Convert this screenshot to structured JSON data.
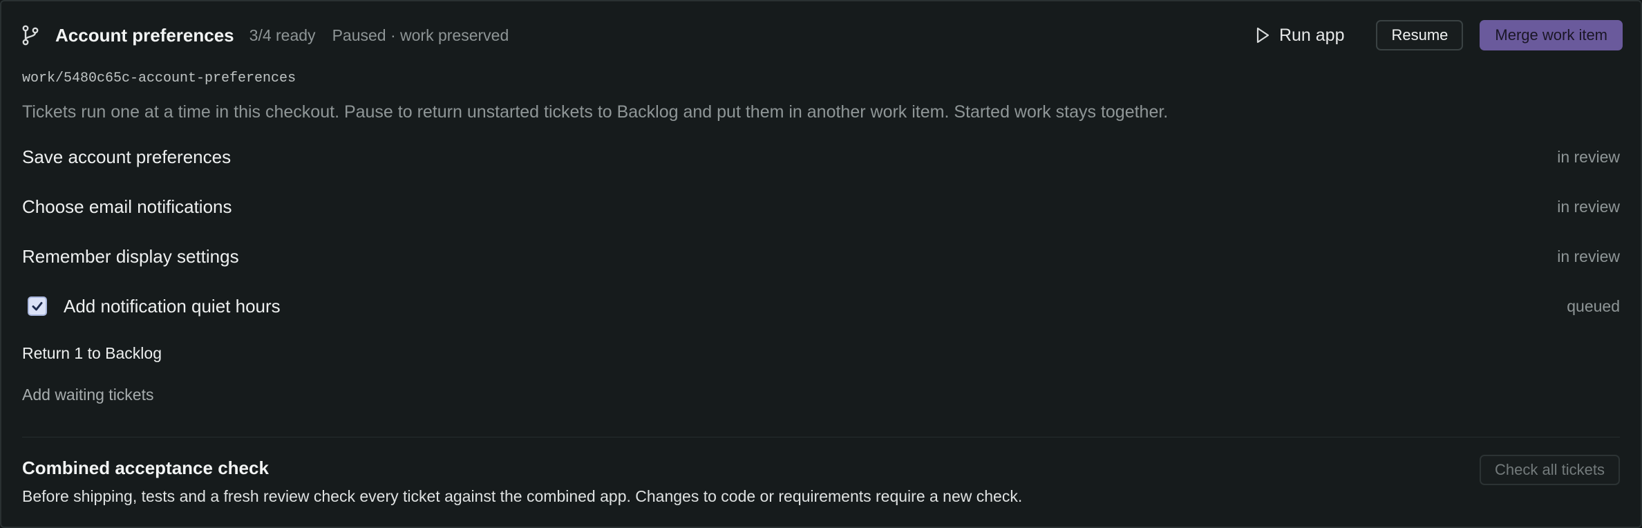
{
  "header": {
    "title": "Account preferences",
    "progress": "3/4 ready",
    "state": "Paused · work preserved",
    "run_label": "Run app",
    "resume_label": "Resume",
    "merge_label": "Merge work item"
  },
  "branch": "work/5480c65c-account-preferences",
  "description": "Tickets run one at a time in this checkout. Pause to return unstarted tickets to Backlog and put them in another work item. Started work stays together.",
  "tickets": [
    {
      "label": "Save account preferences",
      "status": "in review"
    },
    {
      "label": "Choose email notifications",
      "status": "in review"
    },
    {
      "label": "Remember display settings",
      "status": "in review"
    },
    {
      "label": "Add notification quiet hours",
      "status": "queued",
      "checked": true
    }
  ],
  "actions": {
    "return_label": "Return 1 to Backlog",
    "add_label": "Add waiting tickets"
  },
  "acceptance": {
    "title": "Combined acceptance check",
    "description": "Before shipping, tests and a fresh review check every ticket against the combined app. Changes to code or requirements require a new check.",
    "button_label": "Check all tickets"
  },
  "colors": {
    "accent": "#6a5a9c",
    "checkbox": "#dbe2f7",
    "background": "#161b1c"
  }
}
